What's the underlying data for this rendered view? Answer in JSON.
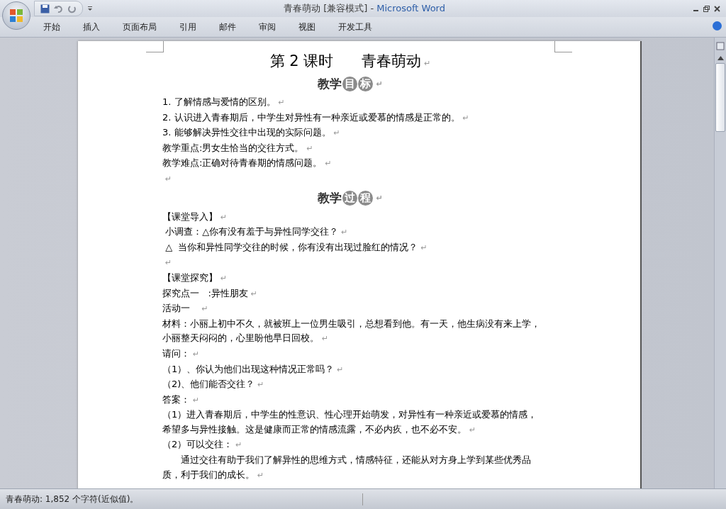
{
  "window": {
    "document_title": "青春萌动 [兼容模式]",
    "separator": "-",
    "app_name": "Microsoft Word"
  },
  "ribbon_tabs": [
    {
      "label": "开始",
      "selected": false
    },
    {
      "label": "插入",
      "selected": false
    },
    {
      "label": "页面布局",
      "selected": false
    },
    {
      "label": "引用",
      "selected": false
    },
    {
      "label": "邮件",
      "selected": false
    },
    {
      "label": "审阅",
      "selected": false
    },
    {
      "label": "视图",
      "selected": false
    },
    {
      "label": "开发工具",
      "selected": false
    }
  ],
  "document": {
    "paragraphs": [
      {
        "kind": "title",
        "parts": [
          "第 2 课时",
          "青春萌动"
        ],
        "mark": "↵"
      },
      {
        "kind": "heading",
        "plain": "教学",
        "circled": [
          "目",
          "标"
        ],
        "mark": "↵"
      },
      {
        "kind": "body",
        "text": "1. 了解情感与爱情的区别。",
        "mark": "↵"
      },
      {
        "kind": "body",
        "text": "2. 认识进入青春期后，中学生对异性有一种亲近或爱慕的情感是正常的。",
        "mark": "↵"
      },
      {
        "kind": "body",
        "text": "3. 能够解决异性交往中出现的实际问题。",
        "mark": "↵"
      },
      {
        "kind": "body",
        "text": "教学重点:男女生恰当的交往方式。",
        "mark": "↵"
      },
      {
        "kind": "body",
        "text": "教学难点:正确对待青春期的情感问题。",
        "mark": "↵"
      },
      {
        "kind": "body",
        "mark": "↵"
      },
      {
        "kind": "heading",
        "plain": "教学",
        "circled": [
          "过",
          "程"
        ],
        "mark": "↵"
      },
      {
        "kind": "body",
        "text": "【课堂导入】",
        "mark": "↵"
      },
      {
        "kind": "body",
        "text": " 小调查：△你有没有羞于与异性同学交往？",
        "mark": "↵"
      },
      {
        "kind": "body",
        "text": " △  当你和异性同学交往的时候，你有没有出现过脸红的情况？",
        "mark": "↵"
      },
      {
        "kind": "body",
        "mark": "↵"
      },
      {
        "kind": "body",
        "text": "【课堂探究】",
        "mark": "↵"
      },
      {
        "kind": "body",
        "text": "探究点一   :异性朋友",
        "mark": "↵"
      },
      {
        "kind": "body",
        "text": "活动一   ",
        "mark": "↵"
      },
      {
        "kind": "lines",
        "lines": [
          "材料：小丽上初中不久，就被班上一位男生吸引，总想看到他。有一天，他生病没有来上学，",
          "小丽整天闷闷的，心里盼他早日回校。"
        ],
        "mark": "↵"
      },
      {
        "kind": "body",
        "text": "请问：",
        "mark": "↵"
      },
      {
        "kind": "body",
        "text": "（1）、你认为他们出现这种情况正常吗？",
        "mark": "↵"
      },
      {
        "kind": "body",
        "text": "（2)、他们能否交往？",
        "mark": "↵"
      },
      {
        "kind": "body",
        "text": "答案：",
        "mark": "↵"
      },
      {
        "kind": "lines",
        "lines": [
          "（1）进入青春期后，中学生的性意识、性心理开始萌发，对异性有一种亲近或爱慕的情感，",
          "希望多与异性接触。这是健康而正常的情感流露，不必内疚，也不必不安。"
        ],
        "mark": "↵"
      },
      {
        "kind": "body",
        "text": "（2）可以交往：",
        "mark": "↵"
      },
      {
        "kind": "lines",
        "lines": [
          "　　通过交往有助于我们了解异性的思维方式，情感特征，还能从对方身上学到某些优秀品",
          "质，利于我们的成长。"
        ],
        "mark": "↵"
      }
    ]
  },
  "status_bar": {
    "word_count": "青春萌动: 1,852 个字符(近似值)。"
  }
}
